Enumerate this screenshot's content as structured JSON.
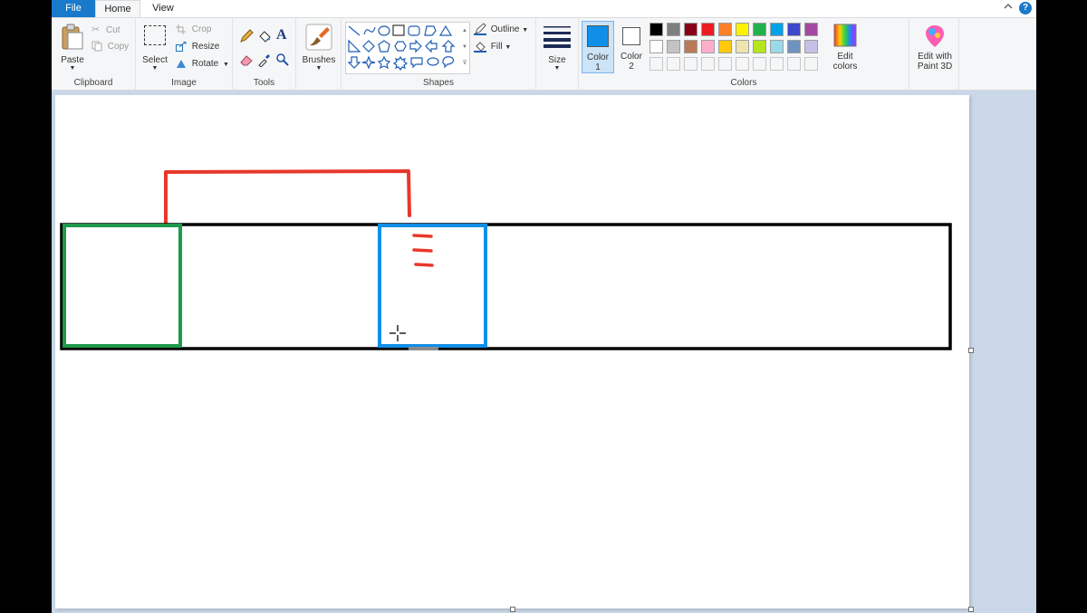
{
  "tabs": {
    "file": "File",
    "home": "Home",
    "view": "View"
  },
  "icons": {
    "minimize_ribbon": "chevron-up-icon",
    "help": "help-icon",
    "help_glyph": "?"
  },
  "clipboard": {
    "paste": "Paste",
    "cut": "Cut",
    "copy": "Copy",
    "group": "Clipboard"
  },
  "image": {
    "select": "Select",
    "crop": "Crop",
    "resize": "Resize",
    "rotate": "Rotate",
    "group": "Image"
  },
  "tools": {
    "group": "Tools",
    "text_glyph": "A"
  },
  "brushes": {
    "label": "Brushes"
  },
  "shapes": {
    "outline": "Outline",
    "fill": "Fill",
    "group": "Shapes"
  },
  "size": {
    "label": "Size"
  },
  "color1": {
    "label": "Color",
    "num": "1",
    "value": "#0f8fe8"
  },
  "color2": {
    "label": "Color",
    "num": "2",
    "value": "#ffffff"
  },
  "colors": {
    "group": "Colors",
    "edit_line1": "Edit",
    "edit_line2": "colors",
    "row1": [
      "#000000",
      "#7f7f7f",
      "#880015",
      "#ed1c24",
      "#ff7f27",
      "#fff200",
      "#22b14c",
      "#00a2e8",
      "#3f48cc",
      "#a349a4"
    ],
    "row2": [
      "#ffffff",
      "#c3c3c3",
      "#b97a57",
      "#ffaec9",
      "#ffc90e",
      "#efe4b0",
      "#b5e61d",
      "#99d9ea",
      "#7092be",
      "#c8bfe7"
    ]
  },
  "paint3d": {
    "line1": "Edit with",
    "line2": "Paint 3D"
  },
  "drawing": {
    "outer_rect_color": "#000000",
    "green_rect_color": "#1e9a4a",
    "blue_rect_color": "#0f8fe8",
    "red_line_color": "#e8382b"
  }
}
